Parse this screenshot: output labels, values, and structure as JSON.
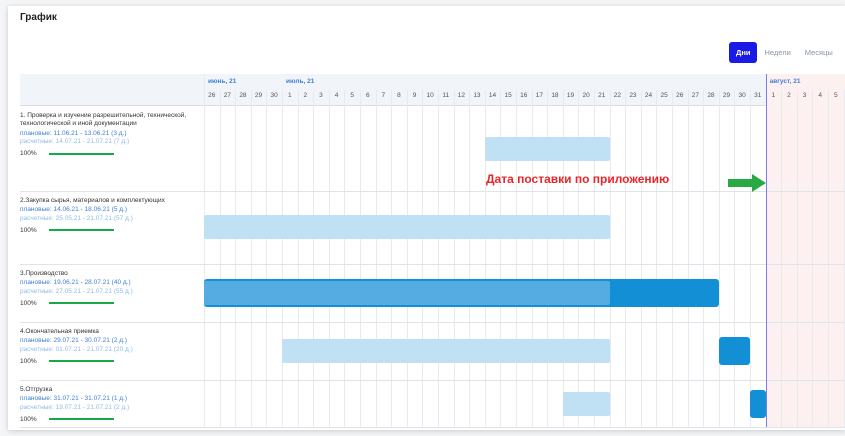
{
  "header": {
    "title": "График"
  },
  "view_switch": {
    "days": "Дни",
    "weeks": "Недели",
    "months": "Месяцы",
    "active": "days"
  },
  "timeline": {
    "months": [
      {
        "label": "июнь, 21"
      },
      {
        "label": "июль, 21"
      },
      {
        "label": "август, 21"
      }
    ],
    "days": [
      "26",
      "27",
      "28",
      "29",
      "30",
      "1",
      "2",
      "3",
      "4",
      "5",
      "6",
      "7",
      "8",
      "9",
      "10",
      "11",
      "12",
      "13",
      "14",
      "15",
      "16",
      "17",
      "18",
      "19",
      "20",
      "21",
      "22",
      "23",
      "24",
      "25",
      "26",
      "27",
      "28",
      "29",
      "30",
      "31",
      "1",
      "2",
      "3",
      "4",
      "5"
    ]
  },
  "tasks": [
    {
      "title": "1. Проверка и изучение разрешительной, технической, технологической и иной документации",
      "plan_label": "плановые:",
      "plan_dates": "11.06.21 - 13.06.21",
      "plan_days": "(3 д.)",
      "calc_label": "расчетные:",
      "calc_dates": "14.07.21 - 21.07.21",
      "calc_days": "(7 д.)",
      "progress_text": "100%",
      "progress": 1.0
    },
    {
      "title": "2.Закупка сырья, материалов и комплектующих",
      "plan_label": "плановые:",
      "plan_dates": "14.06.21 - 18.06.21",
      "plan_days": "(5 д.)",
      "calc_label": "расчетные:",
      "calc_dates": "25.05.21 - 21.07.21",
      "calc_days": "(57 д.)",
      "progress_text": "100%",
      "progress": 1.0
    },
    {
      "title": "3.Производство",
      "plan_label": "плановые:",
      "plan_dates": "19.06.21 - 28.07.21",
      "plan_days": "(40 д.)",
      "calc_label": "расчетные:",
      "calc_dates": "27.05.21 - 21.07.21",
      "calc_days": "(55 д.)",
      "progress_text": "100%",
      "progress": 1.0
    },
    {
      "title": "4.Окончательная приемка",
      "plan_label": "плановые:",
      "plan_dates": "29.07.21 - 30.07.21",
      "plan_days": "(2 д.)",
      "calc_label": "расчетные:",
      "calc_dates": "01.07.21 - 21.07.21",
      "calc_days": "(20 д.)",
      "progress_text": "100%",
      "progress": 1.0
    },
    {
      "title": "5.Отгрузка",
      "plan_label": "плановые:",
      "plan_dates": "31.07.21 - 31.07.21",
      "plan_days": "(1 д.)",
      "calc_label": "расчетные:",
      "calc_dates": "19.07.21 - 21.07.21",
      "calc_days": "(2 д.)",
      "progress_text": "100%",
      "progress": 1.0
    }
  ],
  "annotation": {
    "text": "Дата поставки по приложению"
  },
  "colors": {
    "accent": "#1a1ae6",
    "plan_bar": "#1390d5",
    "calc_bar": "#bfe1f3",
    "progress": "#18a84a",
    "annotation": "#e8262a",
    "arrow": "#2aa844",
    "after_deadline_shade": "#fdf0f1"
  },
  "icons": {
    "arrow": "green-right-arrow-icon"
  }
}
